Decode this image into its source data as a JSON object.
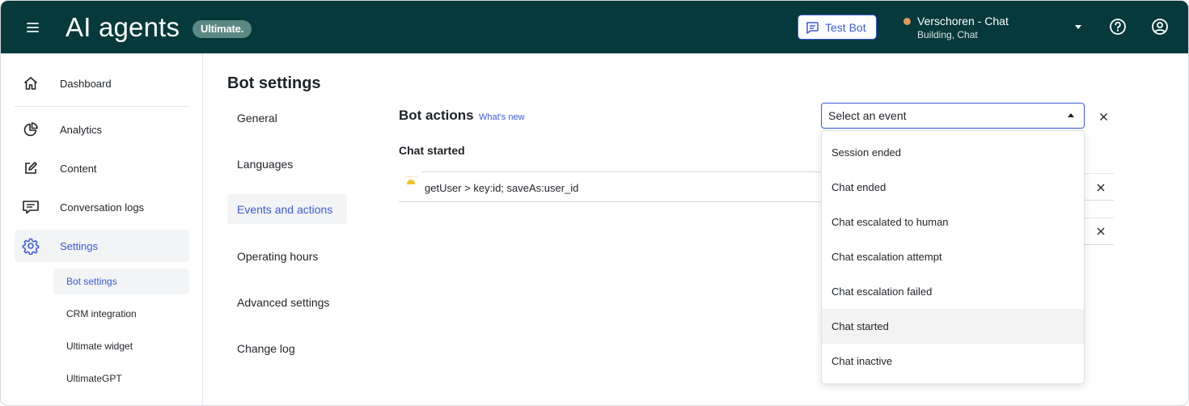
{
  "header": {
    "title": "AI agents",
    "plan_badge": "Ultimate.",
    "test_bot_label": "Test Bot",
    "bot_name": "Verschoren - Chat",
    "bot_status": "Building, Chat",
    "status_color": "#e39a5a"
  },
  "sidebar": {
    "items": [
      {
        "label": "Dashboard",
        "icon": "home-icon"
      },
      {
        "label": "Analytics",
        "icon": "pie-chart-icon"
      },
      {
        "label": "Content",
        "icon": "edit-icon"
      },
      {
        "label": "Conversation logs",
        "icon": "chat-icon"
      },
      {
        "label": "Settings",
        "icon": "gear-icon"
      }
    ],
    "sub_items": [
      {
        "label": "Bot settings"
      },
      {
        "label": "CRM integration"
      },
      {
        "label": "Ultimate widget"
      },
      {
        "label": "UltimateGPT"
      }
    ]
  },
  "main": {
    "page_title": "Bot settings",
    "tabs": [
      {
        "label": "General"
      },
      {
        "label": "Languages"
      },
      {
        "label": "Events and actions"
      },
      {
        "label": "Operating hours"
      },
      {
        "label": "Advanced settings"
      },
      {
        "label": "Change log"
      }
    ],
    "section_title": "Bot actions",
    "whats_new": "What's new",
    "event_label": "Chat started",
    "action_value": "getUser > key:id; saveAs:user_id",
    "event_select": {
      "placeholder": "Select an event",
      "options": [
        {
          "label": "Session ended"
        },
        {
          "label": "Chat ended"
        },
        {
          "label": "Chat escalated to human"
        },
        {
          "label": "Chat escalation attempt"
        },
        {
          "label": "Chat escalation failed"
        },
        {
          "label": "Chat started"
        },
        {
          "label": "Chat inactive"
        }
      ],
      "highlighted": "Chat started"
    }
  },
  "colors": {
    "header_bg": "#05393b",
    "accent": "#3b5bdb",
    "badge_bg": "#5c8884"
  }
}
